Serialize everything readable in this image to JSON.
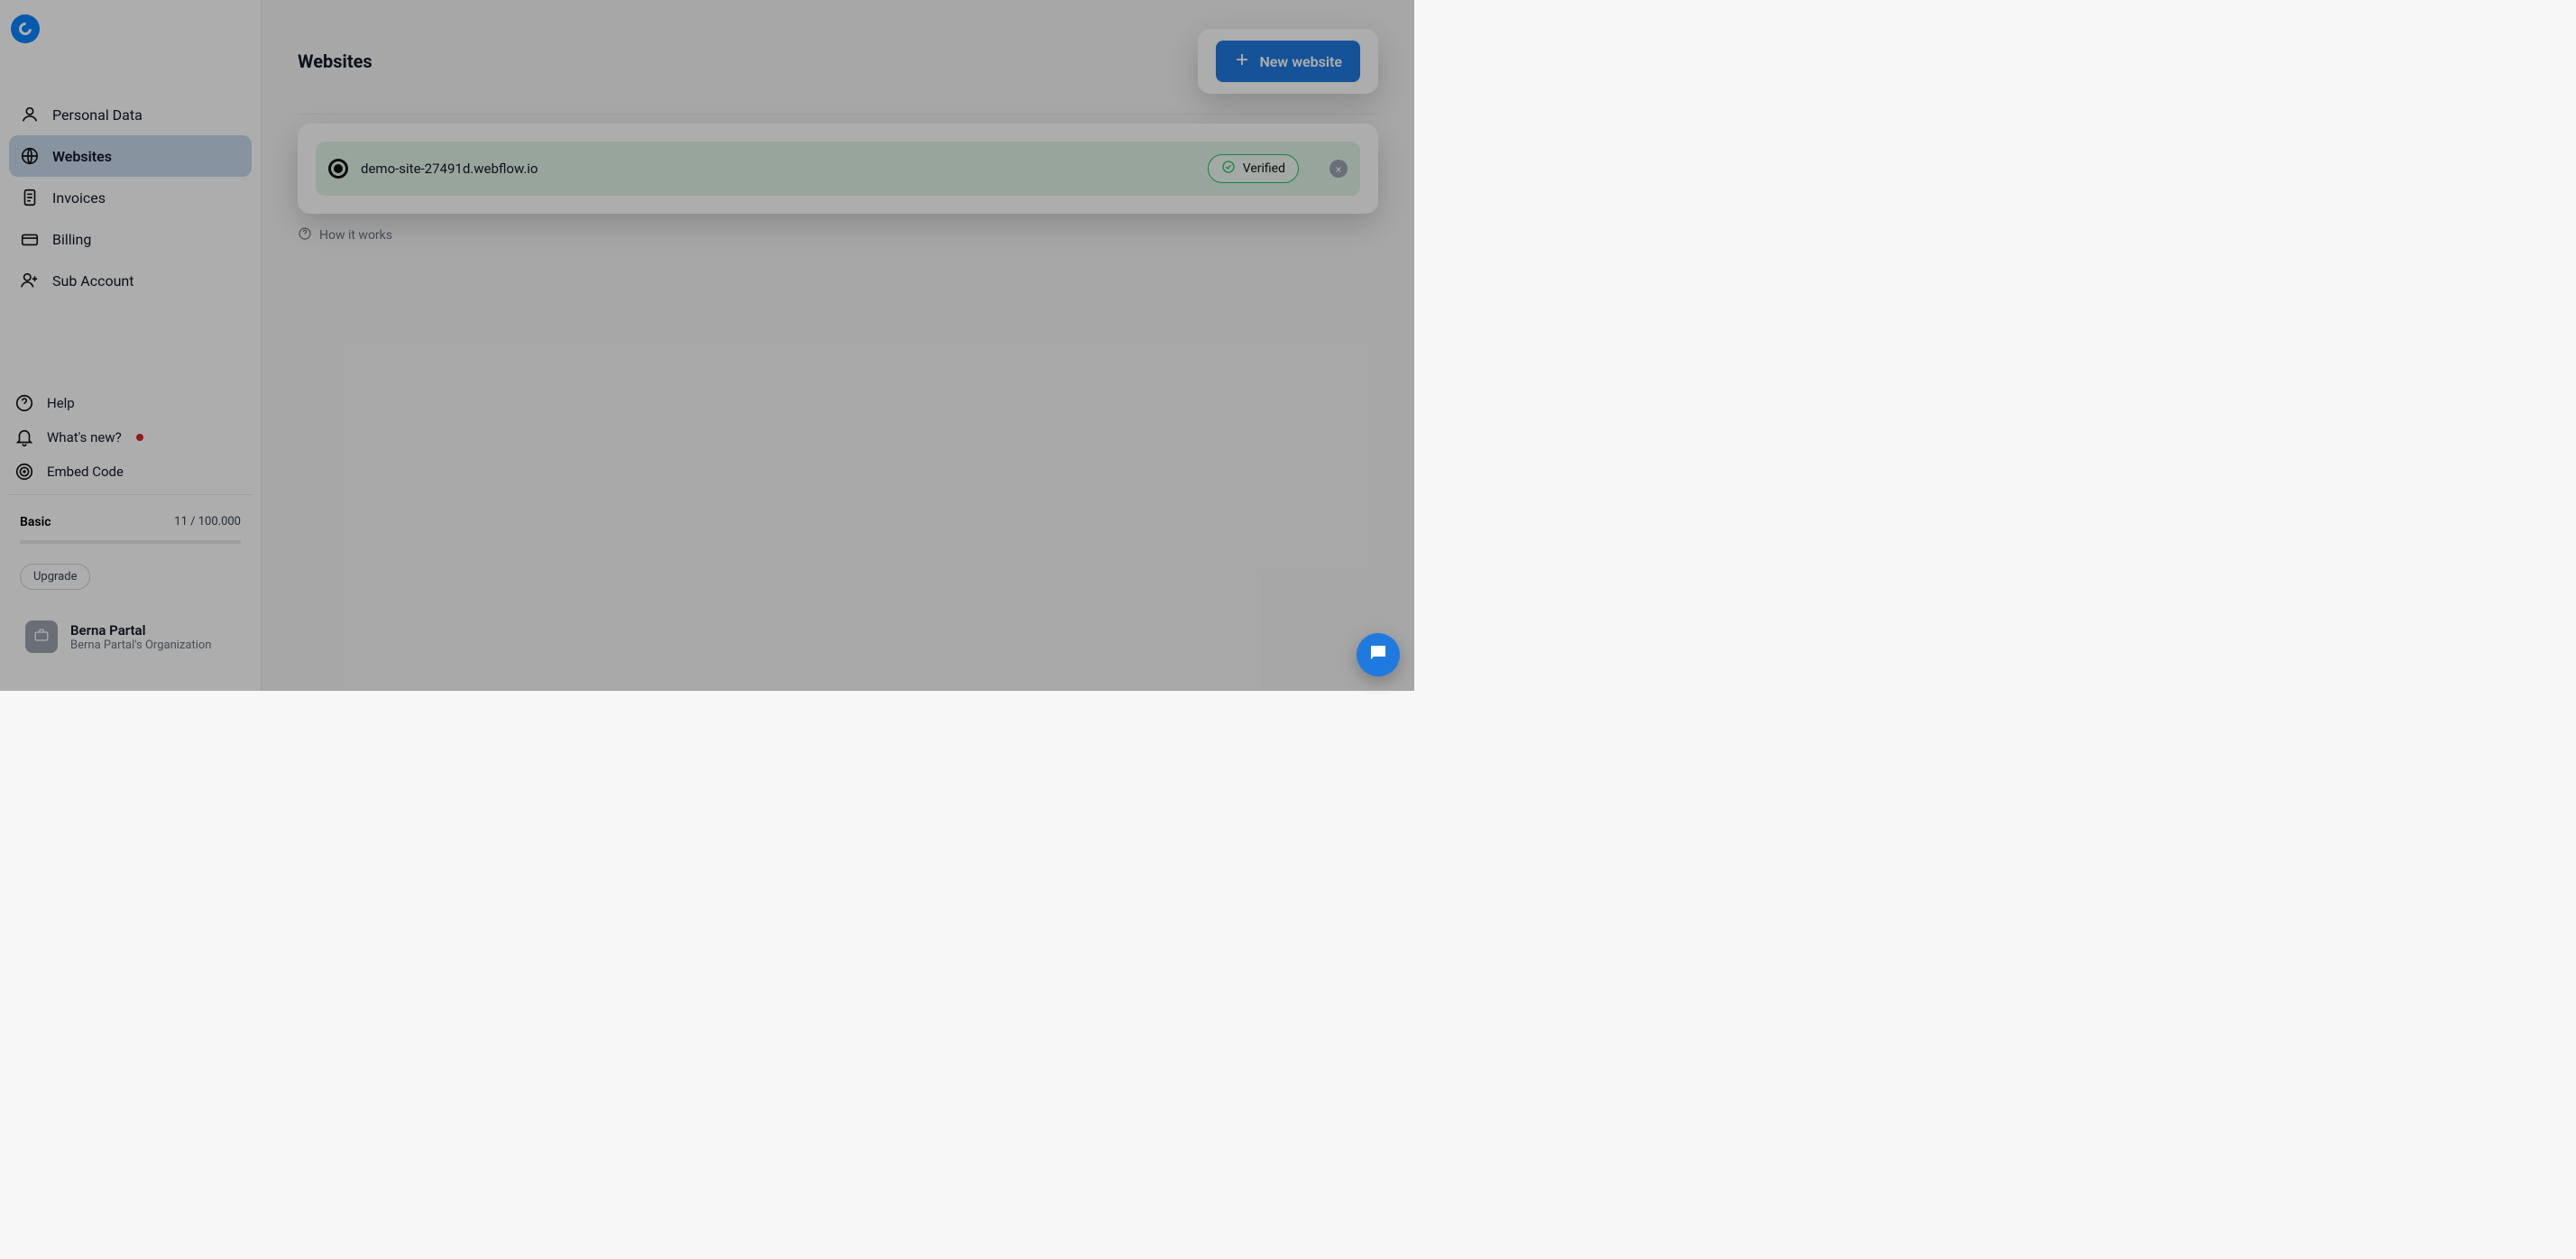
{
  "sidebar": {
    "items": {
      "personal_data": "Personal Data",
      "websites": "Websites",
      "invoices": "Invoices",
      "billing": "Billing",
      "sub_account": "Sub Account"
    },
    "bottom": {
      "help": "Help",
      "whats_new": "What's new?",
      "embed_code": "Embed Code"
    },
    "plan": {
      "name": "Basic",
      "usage": "11 / 100.000",
      "upgrade": "Upgrade"
    },
    "user": {
      "name": "Berna Partal",
      "org": "Berna Partal's Organization"
    }
  },
  "main": {
    "title": "Websites",
    "new_website": "New website",
    "how_it_works": "How it works",
    "site": {
      "url": "demo-site-27491d.webflow.io",
      "status": "Verified"
    }
  }
}
